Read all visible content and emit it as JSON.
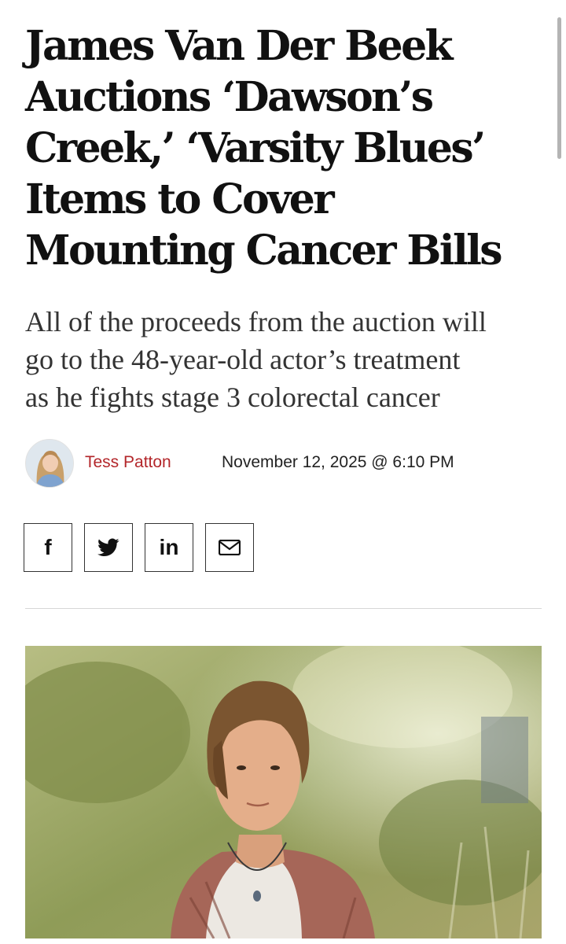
{
  "article": {
    "headline_lines": [
      "James Van Der Beek",
      "Auctions ‘Dawson’s",
      "Creek,’ ‘Varsity Blues’",
      "Items to Cover",
      "Mounting Cancer Bills"
    ],
    "deck_lines": [
      "All of the proceeds from the auction will",
      "go to the 48-year-old actor’s treatment",
      "as he fights stage 3 colorectal cancer"
    ]
  },
  "byline": {
    "author": "Tess Patton",
    "date": "November 12, 2025 @ 6:10 PM",
    "avatar_icon": "author-avatar-photo"
  },
  "share": {
    "buttons": [
      {
        "icon": "facebook-icon",
        "glyph": "f"
      },
      {
        "icon": "twitter-icon",
        "glyph": ""
      },
      {
        "icon": "linkedin-icon",
        "glyph": "in"
      },
      {
        "icon": "email-icon",
        "glyph": ""
      }
    ]
  },
  "colors": {
    "author_link": "#b3262a",
    "headline": "#111111",
    "deck": "#333333"
  }
}
